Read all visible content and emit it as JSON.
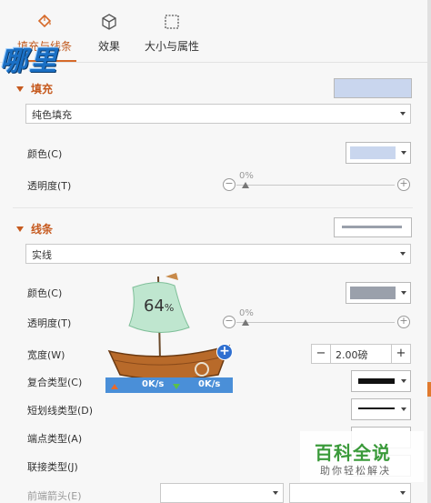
{
  "tabs": [
    {
      "label": "填充与线条",
      "icon": "fill-bucket-icon",
      "active": true
    },
    {
      "label": "效果",
      "icon": "cube-icon",
      "active": false
    },
    {
      "label": "大小与属性",
      "icon": "size-properties-icon",
      "active": false
    }
  ],
  "watermark": "哪里",
  "fill": {
    "section_label": "填充",
    "swatch_color": "#c9d6ee",
    "type_value": "纯色填充",
    "color_label": "颜色(C)",
    "color_value": "#c9d6ee",
    "transparency_label": "透明度(T)",
    "transparency_value": "0%"
  },
  "line": {
    "section_label": "线条",
    "type_value": "实线",
    "color_label": "颜色(C)",
    "color_value": "#9aa0ab",
    "transparency_label": "透明度(T)",
    "transparency_value": "0%",
    "width_label": "宽度(W)",
    "width_value": "2.00磅",
    "compound_label": "复合类型(C)",
    "dash_label": "短划线类型(D)",
    "cap_label": "端点类型(A)",
    "join_label": "联接类型(J)",
    "arrow_label": "前端箭头(E)"
  },
  "overlay": {
    "percent": "64",
    "percent_sign": "%",
    "upload_speed": "0K/s",
    "download_speed": "0K/s"
  },
  "brand": {
    "title": "百科全说",
    "subtitle": "助你轻松解决"
  },
  "colors": {
    "accent": "#c65a1f",
    "fill_swatch": "#c9d6ee",
    "line_swatch": "#9aa0ab"
  }
}
